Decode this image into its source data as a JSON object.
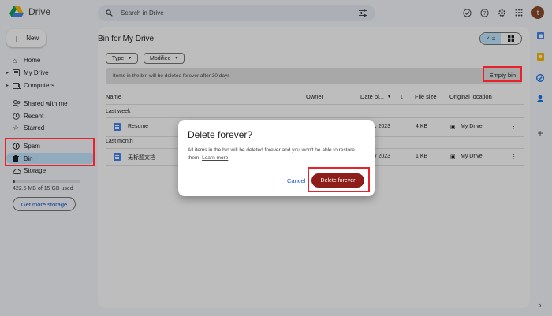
{
  "app": {
    "name": "Drive"
  },
  "search": {
    "placeholder": "Search in Drive"
  },
  "sidebar": {
    "new_label": "New",
    "items": [
      {
        "label": "Home",
        "icon": "home-icon"
      },
      {
        "label": "My Drive",
        "icon": "drive-icon"
      },
      {
        "label": "Computers",
        "icon": "computer-icon"
      },
      {
        "label": "Shared with me",
        "icon": "people-icon"
      },
      {
        "label": "Recent",
        "icon": "clock-icon"
      },
      {
        "label": "Starred",
        "icon": "star-icon"
      },
      {
        "label": "Spam",
        "icon": "spam-icon"
      },
      {
        "label": "Bin",
        "icon": "trash-icon"
      },
      {
        "label": "Storage",
        "icon": "cloud-icon"
      }
    ],
    "storage_used_fraction": 0.03,
    "storage_text": "422.5 MB of 15 GB used",
    "get_more_label": "Get more storage"
  },
  "main": {
    "title": "Bin for My Drive",
    "filters": [
      "Type",
      "Modified"
    ],
    "banner_text": "Items in the bin will be deleted forever after 30 days",
    "empty_bin_label": "Empty bin",
    "columns": {
      "name": "Name",
      "owner": "Owner",
      "date": "Date bi...",
      "size": "File size",
      "location": "Original location"
    },
    "groups": [
      {
        "label": "Last week",
        "rows": [
          {
            "name": "Resume",
            "date": "c 2023",
            "size": "4 KB",
            "location": "My Drive"
          }
        ]
      },
      {
        "label": "Last month",
        "rows": [
          {
            "name": "无标题文档",
            "date": "v 2023",
            "size": "1 KB",
            "location": "My Drive"
          }
        ]
      }
    ]
  },
  "dialog": {
    "title": "Delete forever?",
    "message": "All items in the bin will be deleted forever and you won't be able to restore them.",
    "link": "Learn more",
    "cancel": "Cancel",
    "confirm": "Delete forever"
  },
  "user": {
    "initial": "t"
  },
  "colors": {
    "accent": "#0b57d0",
    "selected": "#c2e7ff",
    "danger": "#8c1d18",
    "highlight": "#e8222a"
  }
}
